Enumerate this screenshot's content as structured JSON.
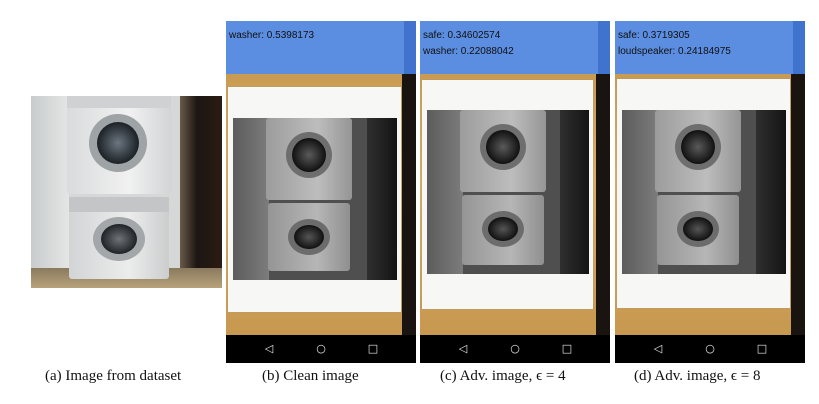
{
  "panels": [
    {
      "caption": "(a) Image from dataset"
    },
    {
      "caption": "(b) Clean image",
      "predictions": [
        "washer: 0.5398173"
      ]
    },
    {
      "caption": "(c) Adv. image, ϵ = 4",
      "predictions": [
        "safe: 0.34602574",
        "washer: 0.22088042"
      ]
    },
    {
      "caption": "(d) Adv. image, ϵ = 8",
      "predictions": [
        "safe: 0.3719305",
        "loudspeaker: 0.24184975"
      ]
    }
  ],
  "navbar": {
    "back_icon": "◁",
    "home_icon": "○",
    "recents_icon": "□"
  },
  "colors": {
    "statusbar": "#5b8de0",
    "washer": "#e8e9ea",
    "tabletop": "#d0a35a"
  }
}
